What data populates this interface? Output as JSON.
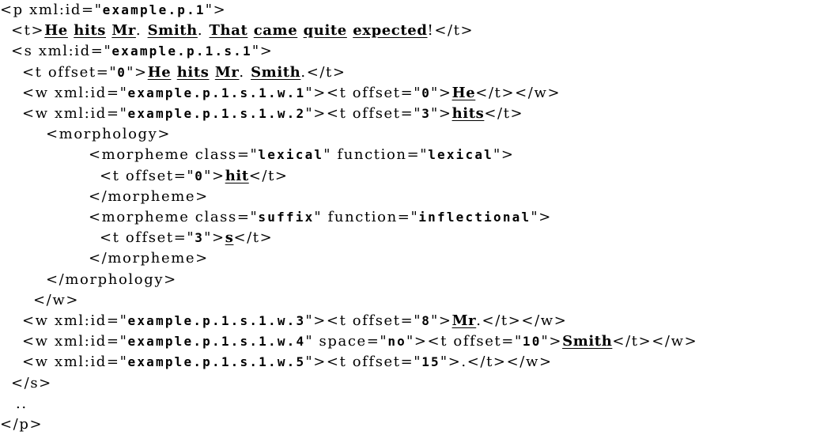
{
  "lines": [
    {
      "indent": 0,
      "parts": [
        {
          "t": "<p xml:id=\""
        },
        {
          "t": "example.p.1",
          "s": "mono"
        },
        {
          "t": "\">"
        }
      ]
    },
    {
      "indent": 14,
      "parts": [
        {
          "t": "<t>"
        },
        {
          "t": "He",
          "s": "emph"
        },
        {
          "t": " "
        },
        {
          "t": "hits",
          "s": "emph"
        },
        {
          "t": " "
        },
        {
          "t": "Mr",
          "s": "emph"
        },
        {
          "t": ". "
        },
        {
          "t": "Smith",
          "s": "emph"
        },
        {
          "t": ". "
        },
        {
          "t": "That",
          "s": "emph"
        },
        {
          "t": " "
        },
        {
          "t": "came",
          "s": "emph"
        },
        {
          "t": " "
        },
        {
          "t": "quite",
          "s": "emph"
        },
        {
          "t": " "
        },
        {
          "t": "expected",
          "s": "emph"
        },
        {
          "t": "!</t>"
        }
      ]
    },
    {
      "indent": 14,
      "parts": [
        {
          "t": "<s xml:id=\""
        },
        {
          "t": "example.p.1.s.1",
          "s": "mono"
        },
        {
          "t": "\">"
        }
      ]
    },
    {
      "indent": 28,
      "parts": [
        {
          "t": "<t offset=\""
        },
        {
          "t": "0",
          "s": "mono"
        },
        {
          "t": "\">"
        },
        {
          "t": "He",
          "s": "emph"
        },
        {
          "t": " "
        },
        {
          "t": "hits",
          "s": "emph"
        },
        {
          "t": " "
        },
        {
          "t": "Mr",
          "s": "emph"
        },
        {
          "t": ". "
        },
        {
          "t": "Smith",
          "s": "emph"
        },
        {
          "t": ".</t>"
        }
      ]
    },
    {
      "indent": 28,
      "parts": [
        {
          "t": "<w xml:id=\""
        },
        {
          "t": "example.p.1.s.1.w.1",
          "s": "mono"
        },
        {
          "t": "\"><t offset=\""
        },
        {
          "t": "0",
          "s": "mono"
        },
        {
          "t": "\">"
        },
        {
          "t": "He",
          "s": "emph"
        },
        {
          "t": "</t></w>"
        }
      ]
    },
    {
      "indent": 28,
      "parts": [
        {
          "t": "<w xml:id=\""
        },
        {
          "t": "example.p.1.s.1.w.2",
          "s": "mono"
        },
        {
          "t": "\"><t offset=\""
        },
        {
          "t": "3",
          "s": "mono"
        },
        {
          "t": "\">"
        },
        {
          "t": "hits",
          "s": "emph"
        },
        {
          "t": "</t>"
        }
      ]
    },
    {
      "indent": 58,
      "parts": [
        {
          "t": "<morphology>"
        }
      ]
    },
    {
      "indent": 112,
      "parts": [
        {
          "t": "<morpheme class=\""
        },
        {
          "t": "lexical",
          "s": "mono"
        },
        {
          "t": "\" function=\""
        },
        {
          "t": "lexical",
          "s": "mono"
        },
        {
          "t": "\">"
        }
      ]
    },
    {
      "indent": 126,
      "parts": [
        {
          "t": "<t offset=\""
        },
        {
          "t": "0",
          "s": "mono"
        },
        {
          "t": "\">"
        },
        {
          "t": "hit",
          "s": "emph"
        },
        {
          "t": "</t>"
        }
      ]
    },
    {
      "indent": 112,
      "parts": [
        {
          "t": "</morpheme>"
        }
      ]
    },
    {
      "indent": 112,
      "parts": [
        {
          "t": "<morpheme class=\""
        },
        {
          "t": "suffix",
          "s": "mono"
        },
        {
          "t": "\" function=\""
        },
        {
          "t": "inflectional",
          "s": "mono"
        },
        {
          "t": "\">"
        }
      ]
    },
    {
      "indent": 126,
      "parts": [
        {
          "t": "<t offset=\""
        },
        {
          "t": "3",
          "s": "mono"
        },
        {
          "t": "\">"
        },
        {
          "t": "s",
          "s": "emph"
        },
        {
          "t": "</t>"
        }
      ]
    },
    {
      "indent": 112,
      "parts": [
        {
          "t": "</morpheme>"
        }
      ]
    },
    {
      "indent": 58,
      "parts": [
        {
          "t": "</morphology>"
        }
      ]
    },
    {
      "indent": 42,
      "parts": [
        {
          "t": "</w>"
        }
      ]
    },
    {
      "indent": 28,
      "parts": [
        {
          "t": "<w xml:id=\""
        },
        {
          "t": "example.p.1.s.1.w.3",
          "s": "mono"
        },
        {
          "t": "\"><t offset=\""
        },
        {
          "t": "8",
          "s": "mono"
        },
        {
          "t": "\">"
        },
        {
          "t": "Mr",
          "s": "emph"
        },
        {
          "t": ".</t></w>"
        }
      ]
    },
    {
      "indent": 28,
      "parts": [
        {
          "t": "<w xml:id=\""
        },
        {
          "t": "example.p.1.s.1.w.4",
          "s": "mono"
        },
        {
          "t": "\" space=\""
        },
        {
          "t": "no",
          "s": "mono"
        },
        {
          "t": "\"><t offset=\""
        },
        {
          "t": "10",
          "s": "mono"
        },
        {
          "t": "\">"
        },
        {
          "t": "Smith",
          "s": "emph"
        },
        {
          "t": "</t></w>"
        }
      ]
    },
    {
      "indent": 28,
      "parts": [
        {
          "t": "<w xml:id=\""
        },
        {
          "t": "example.p.1.s.1.w.5",
          "s": "mono"
        },
        {
          "t": "\"><t offset=\""
        },
        {
          "t": "15",
          "s": "mono"
        },
        {
          "t": "\">.</t></w>"
        }
      ]
    },
    {
      "indent": 14,
      "parts": [
        {
          "t": "</s>"
        }
      ]
    },
    {
      "indent": 20,
      "parts": [
        {
          "t": ".."
        }
      ]
    },
    {
      "indent": 0,
      "parts": [
        {
          "t": "</p>"
        }
      ]
    }
  ]
}
